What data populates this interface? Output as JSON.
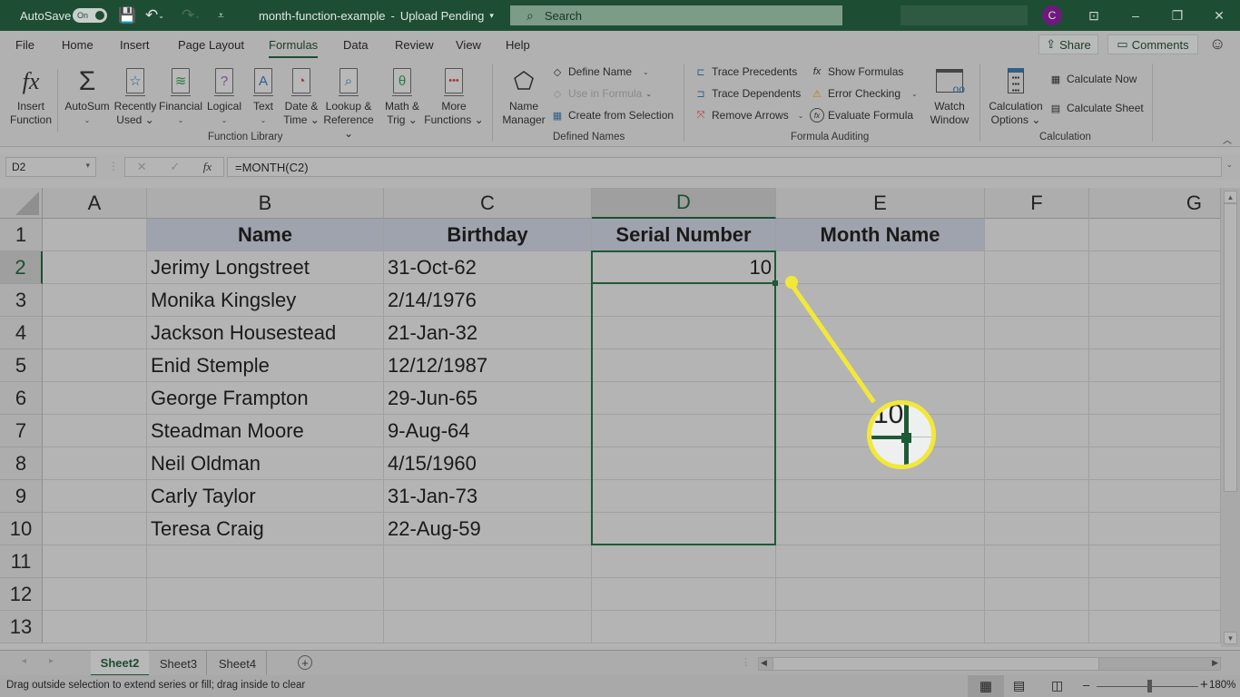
{
  "titlebar": {
    "autosave_label": "AutoSave",
    "autosave_state": "On",
    "doc_title": "month-function-example",
    "separator": "-",
    "upload_status": "Upload Pending",
    "search_placeholder": "Search",
    "avatar_initial": "C",
    "minimize": "–",
    "restore": "❐",
    "close": "✕",
    "ribbon_display": "⊡"
  },
  "menu": {
    "items": [
      "File",
      "Home",
      "Insert",
      "Page Layout",
      "Formulas",
      "Data",
      "Review",
      "View",
      "Help"
    ],
    "active": "Formulas",
    "share": "Share",
    "comments": "Comments",
    "smiley": "☺"
  },
  "ribbon": {
    "function_library": {
      "group_label": "Function Library",
      "buttons": [
        {
          "line1": "Insert",
          "line2": "Function",
          "icon": "fx-icon"
        },
        {
          "line1": "AutoSum",
          "line2": "⌄",
          "icon": "sigma-icon"
        },
        {
          "line1": "Recently",
          "line2": "Used ⌄",
          "icon": "star-book-icon"
        },
        {
          "line1": "Financial",
          "line2": "⌄",
          "icon": "coins-book-icon"
        },
        {
          "line1": "Logical",
          "line2": "⌄",
          "icon": "question-book-icon"
        },
        {
          "line1": "Text",
          "line2": "⌄",
          "icon": "text-book-icon"
        },
        {
          "line1": "Date &",
          "line2": "Time ⌄",
          "icon": "clock-book-icon"
        },
        {
          "line1": "Lookup &",
          "line2": "Reference ⌄",
          "icon": "magnifier-book-icon"
        },
        {
          "line1": "Math &",
          "line2": "Trig ⌄",
          "icon": "theta-book-icon"
        },
        {
          "line1": "More",
          "line2": "Functions ⌄",
          "icon": "more-book-icon"
        }
      ]
    },
    "defined_names": {
      "group_label": "Defined Names",
      "name_manager_line1": "Name",
      "name_manager_line2": "Manager",
      "define_name": "Define Name",
      "use_in_formula": "Use in Formula",
      "create_from_selection": "Create from Selection"
    },
    "formula_auditing": {
      "group_label": "Formula Auditing",
      "trace_precedents": "Trace Precedents",
      "trace_dependents": "Trace Dependents",
      "remove_arrows": "Remove Arrows",
      "show_formulas": "Show Formulas",
      "error_checking": "Error Checking",
      "evaluate_formula": "Evaluate Formula",
      "watch_window_line1": "Watch",
      "watch_window_line2": "Window"
    },
    "calculation": {
      "group_label": "Calculation",
      "options_line1": "Calculation",
      "options_line2": "Options ⌄",
      "calculate_now": "Calculate Now",
      "calculate_sheet": "Calculate Sheet"
    }
  },
  "formula_bar": {
    "name_box": "D2",
    "cancel": "✕",
    "enter": "✓",
    "fx": "fx",
    "formula": "=MONTH(C2)"
  },
  "sheet": {
    "columns": [
      "A",
      "B",
      "C",
      "D",
      "E",
      "F",
      "G"
    ],
    "selected_column": "D",
    "rows": [
      "1",
      "2",
      "3",
      "4",
      "5",
      "6",
      "7",
      "8",
      "9",
      "10",
      "11",
      "12",
      "13"
    ],
    "selected_row": "2",
    "headers": {
      "B": "Name",
      "C": "Birthday",
      "D": "Serial Number",
      "E": "Month Name"
    },
    "data": [
      {
        "name": "Jerimy Longstreet",
        "birthday": "31-Oct-62",
        "serial": "10",
        "month": ""
      },
      {
        "name": "Monika Kingsley",
        "birthday": "2/14/1976",
        "serial": "",
        "month": ""
      },
      {
        "name": "Jackson Housestead",
        "birthday": "21-Jan-32",
        "serial": "",
        "month": ""
      },
      {
        "name": "Enid Stemple",
        "birthday": "12/12/1987",
        "serial": "",
        "month": ""
      },
      {
        "name": "George Frampton",
        "birthday": "29-Jun-65",
        "serial": "",
        "month": ""
      },
      {
        "name": "Steadman Moore",
        "birthday": "9-Aug-64",
        "serial": "",
        "month": ""
      },
      {
        "name": "Neil Oldman",
        "birthday": "4/15/1960",
        "serial": "",
        "month": ""
      },
      {
        "name": "Carly Taylor",
        "birthday": "31-Jan-73",
        "serial": "",
        "month": ""
      },
      {
        "name": "Teresa Craig",
        "birthday": "22-Aug-59",
        "serial": "",
        "month": ""
      }
    ],
    "callout_text": "10"
  },
  "tabs": {
    "sheets": [
      "Sheet2",
      "Sheet3",
      "Sheet4"
    ],
    "active": "Sheet2",
    "add": "+"
  },
  "status": {
    "message": "Drag outside selection to extend series or fill; drag inside to clear",
    "zoom": "180%",
    "zoom_minus": "–",
    "zoom_plus": "+"
  },
  "colors": {
    "excel_green": "#1d4e33",
    "header_fill": "#9ea3ad",
    "selection": "#1d5a37",
    "callout": "#f2e83a"
  }
}
